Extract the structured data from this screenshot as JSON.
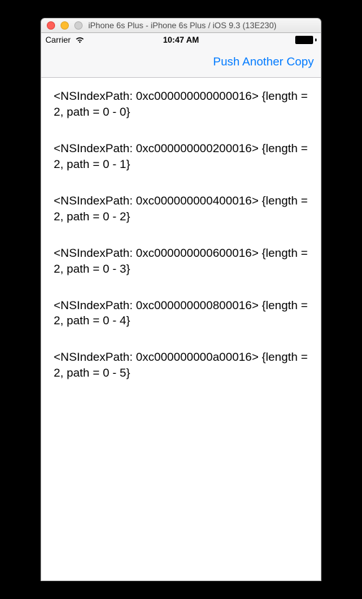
{
  "window": {
    "title": "iPhone 6s Plus - iPhone 6s Plus / iOS 9.3 (13E230)"
  },
  "status": {
    "carrier": "Carrier",
    "time": "10:47 AM"
  },
  "nav": {
    "push_label": "Push Another Copy"
  },
  "rows": [
    {
      "text": "<NSIndexPath: 0xc000000000000016> {length = 2, path = 0 - 0}"
    },
    {
      "text": "<NSIndexPath: 0xc000000000200016> {length = 2, path = 0 - 1}"
    },
    {
      "text": "<NSIndexPath: 0xc000000000400016> {length = 2, path = 0 - 2}"
    },
    {
      "text": "<NSIndexPath: 0xc000000000600016> {length = 2, path = 0 - 3}"
    },
    {
      "text": "<NSIndexPath: 0xc000000000800016> {length = 2, path = 0 - 4}"
    },
    {
      "text": "<NSIndexPath: 0xc000000000a00016> {length = 2, path = 0 - 5}"
    }
  ]
}
